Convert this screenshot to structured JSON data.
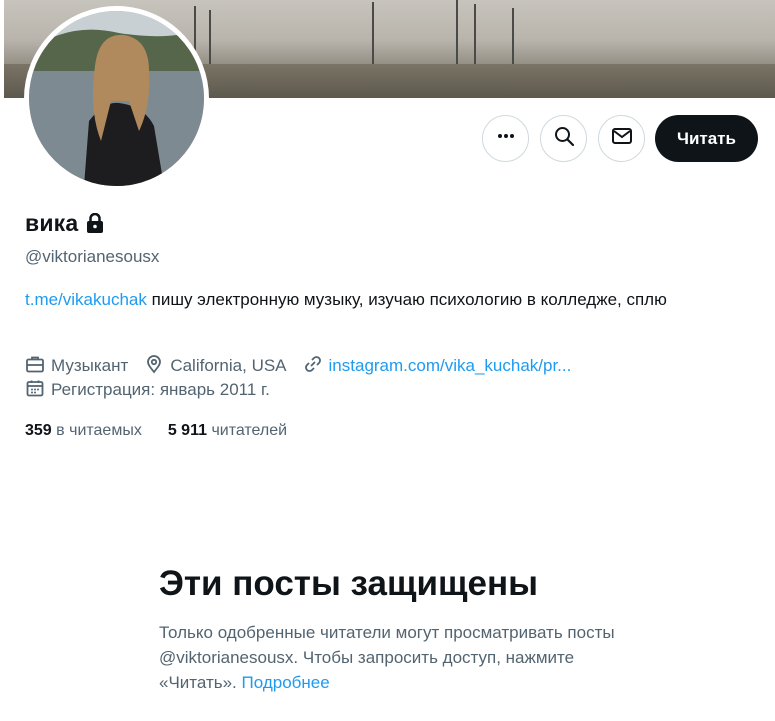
{
  "profile": {
    "display_name": "вика",
    "handle": "@viktorianesousx",
    "bio_link": "t.me/vikakuchak",
    "bio_text": " пишу электронную музыку, изучаю психологию в колледже, сплю",
    "profession": "Музыкант",
    "location": "California, USA",
    "website": "instagram.com/vika_kuchak/pr...",
    "joined": "Регистрация: январь 2011 г."
  },
  "actions": {
    "more_icon": "more-horizontal-icon",
    "search_icon": "search-icon",
    "message_icon": "envelope-icon",
    "follow_label": "Читать"
  },
  "stats": {
    "following_count": "359",
    "following_label": "в читаемых",
    "followers_count": "5 911",
    "followers_label": "читателей"
  },
  "protected": {
    "title": "Эти посты защищены",
    "text": "Только одобренные читатели могут просматривать посты @viktorianesousx. Чтобы запросить доступ, нажмите «Читать». ",
    "learn_more": "Подробнее"
  },
  "colors": {
    "accent": "#1d9bf0",
    "primary_text": "#0f1419",
    "secondary_text": "#536471",
    "button_dark": "#0f1419"
  }
}
